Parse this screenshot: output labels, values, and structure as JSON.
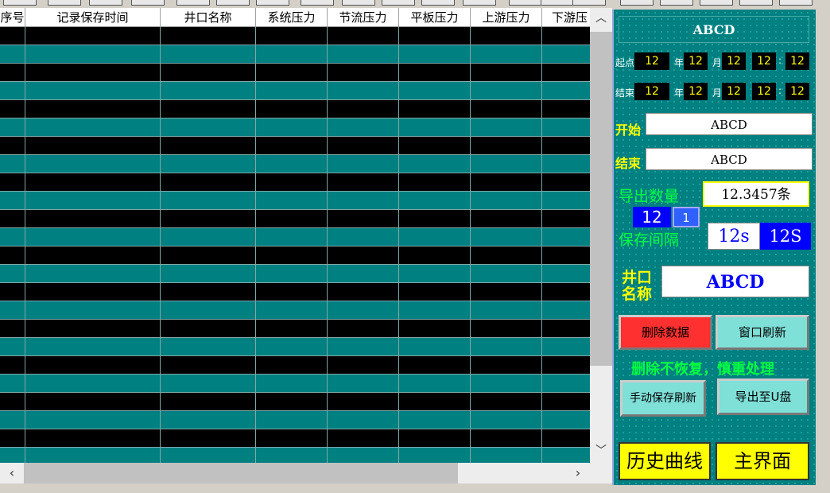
{
  "table": {
    "headers": [
      "序号",
      "记录保存时间",
      "井口名称",
      "系统压力",
      "节流压力",
      "平板压力",
      "上游压力",
      "下游压"
    ],
    "row_count": 24
  },
  "panel": {
    "title": "ABCD",
    "start_label": "起点",
    "end_label": "结束",
    "year_label": "年",
    "month_label": "月",
    "colon": ":",
    "start_time": {
      "year": "12",
      "month": "12",
      "day": "12",
      "hour": "12",
      "minute": "12"
    },
    "end_time": {
      "year": "12",
      "month": "12",
      "day": "12",
      "hour": "12",
      "minute": "12"
    },
    "begin_label": "开始",
    "begin_value": "ABCD",
    "finish_label": "结束",
    "finish_value": "ABCD",
    "export_count_label": "导出数量",
    "export_count_value": "12.3457条",
    "interval_a": "12",
    "interval_b": "1",
    "save_interval_label": "保存间隔",
    "save_interval_value": "12s",
    "save_interval_setting": "12S",
    "well_label_1": "井口",
    "well_label_2": "名称",
    "well_name": "ABCD",
    "delete_button": "删除数据",
    "refresh_button": "窗口刷新",
    "warning": "删除不恢复，慎重处理",
    "manual_save_button": "手动保存刷新",
    "export_usb_button": "导出至U盘",
    "history_button": "历史曲线",
    "main_button": "主界面"
  },
  "colors": {
    "panel_bg": "#008080",
    "row_dark": "#000000",
    "row_teal": "#008080",
    "accent_yellow": "#ffff00",
    "warning_green": "#00ff40",
    "delete_red": "#ff3030",
    "button_cyan": "#7fe0d8"
  }
}
